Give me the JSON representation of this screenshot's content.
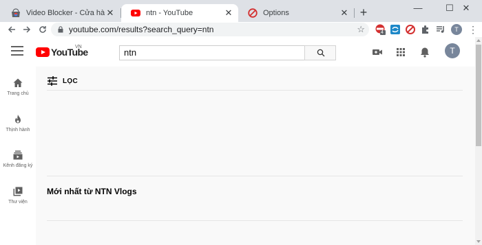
{
  "browser": {
    "tabs": [
      {
        "title": "Video Blocker - Cửa hàng Chrome",
        "favicon": "chrome-web-store-icon",
        "active": false
      },
      {
        "title": "ntn - YouTube",
        "favicon": "youtube-icon",
        "active": true
      },
      {
        "title": "Options",
        "favicon": "video-blocker-icon",
        "active": false
      }
    ],
    "close_glyph": "✕",
    "new_tab_glyph": "+",
    "window_controls": {
      "minimize": "—",
      "maximize": "☐",
      "close": "✕"
    },
    "url": "youtube.com/results?search_query=ntn",
    "extension_badge": "4",
    "profile_initial": "T"
  },
  "youtube": {
    "logo_text": "YouTube",
    "country_code": "VN",
    "search_value": "ntn",
    "profile_initial": "T",
    "guide": [
      {
        "label": "Trang chủ",
        "icon": "home-icon"
      },
      {
        "label": "Thịnh hành",
        "icon": "trending-icon"
      },
      {
        "label": "Kênh đăng ký",
        "icon": "subscriptions-icon"
      },
      {
        "label": "Thư viện",
        "icon": "library-icon"
      }
    ],
    "filter_label": "LỌC",
    "shelf_title": "Mới nhất từ NTN Vlogs"
  },
  "colors": {
    "tabstrip_bg": "#dee1e6",
    "youtube_red": "#ff0000",
    "avatar_bg": "#78869b",
    "page_bg": "#f9f9f9"
  }
}
